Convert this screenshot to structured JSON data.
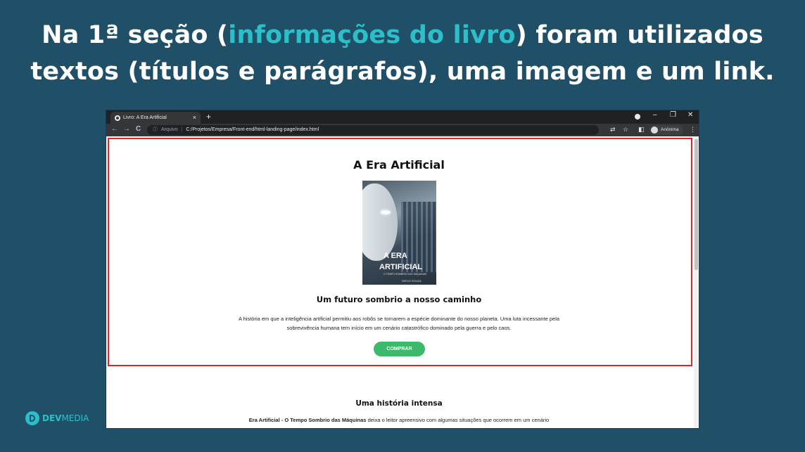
{
  "slide": {
    "title_line1_prefix": "Na 1ª seção (",
    "title_highlight": "informações do livro",
    "title_line1_suffix": ") foram utilizados",
    "title_line2": "textos (títulos e parágrafos), uma imagem e um link."
  },
  "browser": {
    "tab_title": "Livro: A Era Artificial",
    "tab_close": "×",
    "new_tab": "+",
    "window_controls": {
      "minimize": "–",
      "restore": "❐",
      "close": "✕"
    },
    "nav": {
      "back": "←",
      "forward": "→",
      "reload": "C"
    },
    "url_info": "Arquivo",
    "url_separator": "|",
    "url": "C:/Projetos/Empresa/Front-end/html-landing-page/index.html",
    "profile_name": "Anônima",
    "menu": "⋮"
  },
  "page": {
    "book_title": "A Era Artificial",
    "cover": {
      "line1": "A ERA",
      "line2": "ARTIFICIAL",
      "line3": "O TEMPO SOMBRIO DAS MÁQUINAS",
      "author": "DIEGO SOUZA"
    },
    "subtitle": "Um futuro sombrio a nosso caminho",
    "description": "A história em que a inteligência artificial permitiu aos robôs se tornarem a espécie dominante do nosso planeta. Uma luta incessante pela sobrevivência humana tem início em um cenário catastrófico dominado pela guerra e pelo caos.",
    "buy_button": "COMPRAR",
    "section2_title": "Uma história intensa",
    "section2_bold": "Era Artificial - O Tempo Sombrio das Máquinas",
    "section2_text": " deixa o leitor apreensivo com algumas situações que ocorrem em um cenário"
  },
  "logo": {
    "dev": "DEV",
    "media": "MEDIA"
  },
  "colors": {
    "background": "#1f5068",
    "highlight": "#2bc0c9",
    "button": "#3cb96b",
    "frame": "#e0242a"
  }
}
